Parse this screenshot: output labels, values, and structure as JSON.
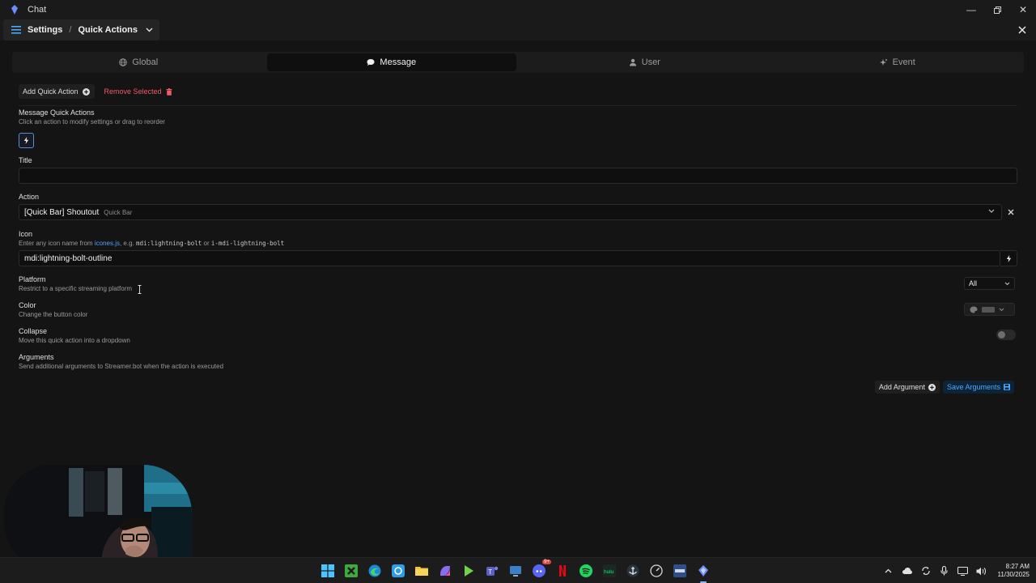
{
  "window": {
    "title": "Chat"
  },
  "header": {
    "crumbs": [
      "Settings",
      "Quick Actions"
    ]
  },
  "tabs": [
    {
      "label": "Global",
      "icon": "globe-icon",
      "active": false
    },
    {
      "label": "Message",
      "icon": "chat-bubble-icon",
      "active": true
    },
    {
      "label": "User",
      "icon": "user-icon",
      "active": false
    },
    {
      "label": "Event",
      "icon": "sparkle-icon",
      "active": false
    }
  ],
  "toolbar": {
    "add_label": "Add Quick Action",
    "remove_label": "Remove Selected"
  },
  "quick_actions": {
    "title": "Message Quick Actions",
    "subtitle": "Click an action to modify settings or drag to reorder"
  },
  "form": {
    "title_label": "Title",
    "title_value": "",
    "action_label": "Action",
    "action_value": "[Quick Bar] Shoutout",
    "action_group": "Quick Bar",
    "icon_label": "Icon",
    "icon_help_prefix": "Enter any icon name from",
    "icon_help_link": "icones.js",
    "icon_help_mid": ", e.g.",
    "icon_example_1": "mdi:lightning-bolt",
    "icon_help_or": "or",
    "icon_example_2": "i-mdi-lightning-bolt",
    "icon_value": "mdi:lightning-bolt-outline",
    "platform_label": "Platform",
    "platform_help": "Restrict to a specific streaming platform",
    "platform_value": "All",
    "color_label": "Color",
    "color_help": "Change the button color",
    "color_value": "#555555",
    "collapse_label": "Collapse",
    "collapse_help": "Move this quick action into a dropdown",
    "collapse_on": false,
    "arguments_label": "Arguments",
    "arguments_help": "Send additional arguments to Streamer.bot when the action is executed",
    "add_argument_label": "Add Argument",
    "save_arguments_label": "Save Arguments"
  },
  "clock": {
    "time": "8:27 AM",
    "date": "11/30/2025"
  },
  "colors": {
    "accent": "#4aa8ff",
    "danger": "#f05a6a",
    "background": "#141414"
  }
}
